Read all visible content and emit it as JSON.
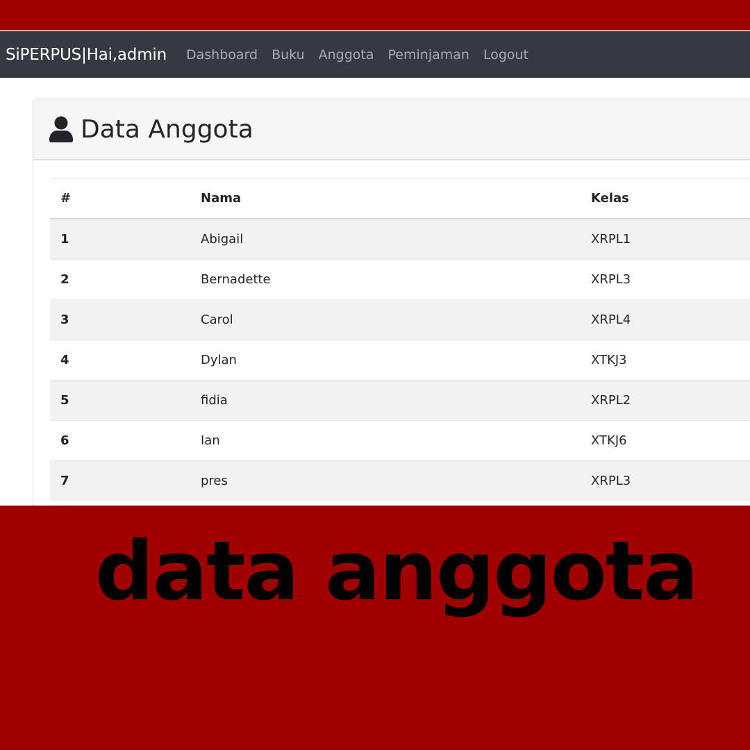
{
  "navbar": {
    "brand": "SiPERPUS|Hai,admin",
    "links": [
      "Dashboard",
      "Buku",
      "Anggota",
      "Peminjaman",
      "Logout"
    ]
  },
  "card": {
    "icon": "user-icon",
    "title": "Data Anggota"
  },
  "table": {
    "headers": [
      "#",
      "Nama",
      "Kelas"
    ],
    "rows": [
      [
        "1",
        "Abigail",
        "XRPL1"
      ],
      [
        "2",
        "Bernadette",
        "XRPL3"
      ],
      [
        "3",
        "Carol",
        "XRPL4"
      ],
      [
        "4",
        "Dylan",
        "XTKJ3"
      ],
      [
        "5",
        "fidia",
        "XRPL2"
      ],
      [
        "6",
        "Ian",
        "XTKJ6"
      ],
      [
        "7",
        "pres",
        "XRPL3"
      ]
    ]
  },
  "caption": "data anggota",
  "colors": {
    "background": "#a00000",
    "navbar": "#343a40",
    "caption_text": "#000000"
  }
}
